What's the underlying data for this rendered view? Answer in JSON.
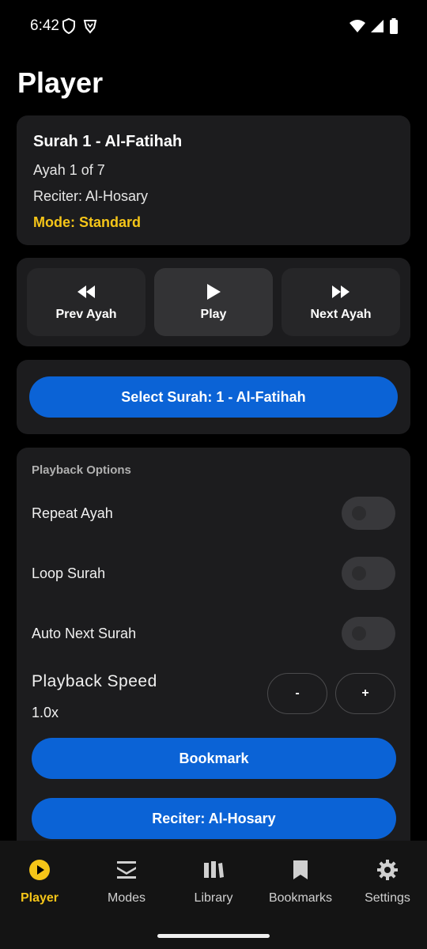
{
  "status_bar": {
    "time": "6:42"
  },
  "page": {
    "title": "Player"
  },
  "now_playing": {
    "surah": "Surah 1 - Al-Fatihah",
    "ayah": "Ayah 1 of 7",
    "reciter": "Reciter: Al-Hosary",
    "mode": "Mode: Standard"
  },
  "controls": {
    "prev_label": "Prev Ayah",
    "play_label": "Play",
    "next_label": "Next Ayah"
  },
  "select_surah": {
    "label": "Select Surah: 1 - Al-Fatihah"
  },
  "options": {
    "section_title": "Playback Options",
    "toggles": [
      {
        "label": "Repeat Ayah",
        "on": false
      },
      {
        "label": "Loop Surah",
        "on": false
      },
      {
        "label": "Auto Next Surah",
        "on": false
      }
    ],
    "speed_label": "Playback Speed",
    "speed_value": "1.0x",
    "speed_minus": "-",
    "speed_plus": "+",
    "bookmark_label": "Bookmark",
    "reciter_label": "Reciter: Al-Hosary"
  },
  "nav": {
    "items": [
      {
        "label": "Player",
        "icon": "play-circle-icon",
        "active": true
      },
      {
        "label": "Modes",
        "icon": "layers-icon",
        "active": false
      },
      {
        "label": "Library",
        "icon": "library-icon",
        "active": false
      },
      {
        "label": "Bookmarks",
        "icon": "bookmark-icon",
        "active": false
      },
      {
        "label": "Settings",
        "icon": "gear-icon",
        "active": false
      }
    ]
  },
  "colors": {
    "accent": "#f5c518",
    "primary_button": "#0b63d6",
    "card": "#1c1c1e",
    "background": "#000000"
  }
}
